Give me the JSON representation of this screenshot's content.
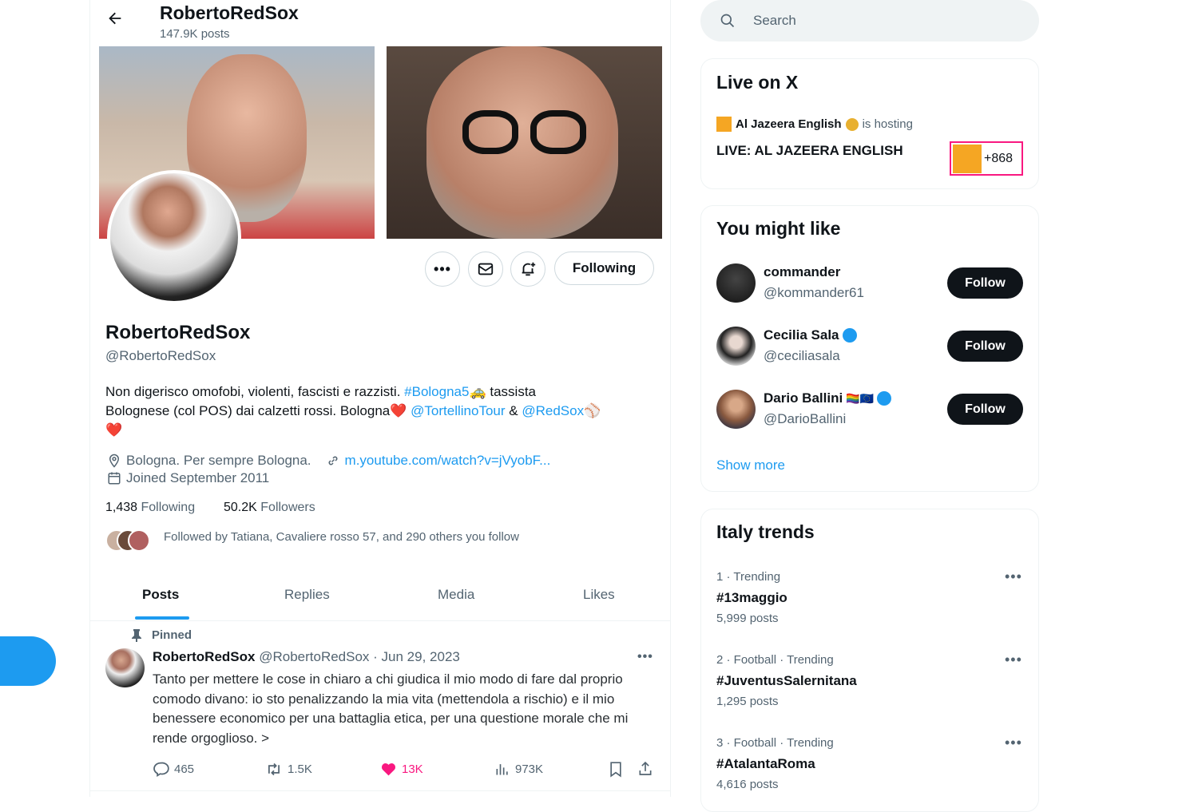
{
  "header": {
    "title": "RobertoRedSox",
    "post_count": "147.9K posts"
  },
  "profile": {
    "name": "RobertoRedSox",
    "handle": "@RobertoRedSox",
    "bio": {
      "line1_text": "Non digerisco omofobi, violenti, fascisti e razzisti. ",
      "hashtag": "#Bologna5",
      "emoji_taxi": "🚕",
      "line1_rest": " tassista",
      "line2_text": "Bolognese (col POS) dai calzetti rossi. Bologna",
      "emoji_heart": "❤️",
      "mention1": "@TortellinoTour",
      "amp": " & ",
      "mention2": "@RedSox",
      "emoji_ball": "⚾"
    },
    "location": "Bologna. Per sempre Bologna.",
    "website": "m.youtube.com/watch?v=jVyobF...",
    "joined": "Joined September 2011",
    "following_count": "1,438",
    "following_label": "Following",
    "followers_count": "50.2K",
    "followers_label": "Followers",
    "followed_by": "Followed by Tatiana, Cavaliere rosso 57, and 290 others you follow",
    "following_button": "Following"
  },
  "tabs": [
    "Posts",
    "Replies",
    "Media",
    "Likes"
  ],
  "active_tab": "Posts",
  "pinned_post": {
    "pinned_label": "Pinned",
    "author": "RobertoRedSox",
    "handle": "@RobertoRedSox",
    "date": "· Jun 29, 2023",
    "text": "Tanto per mettere le cose in chiaro a chi giudica il mio modo di fare dal proprio comodo divano: io sto penalizzando la mia vita (mettendola a rischio) e il mio benessere economico per una battaglia etica, per una questione morale che mi rende orgoglioso. >",
    "replies": "465",
    "reposts": "1.5K",
    "likes": "13K",
    "views": "973K"
  },
  "search": {
    "placeholder": "Search"
  },
  "live": {
    "title": "Live on X",
    "host": "Al Jazeera English",
    "hosting": "is hosting",
    "stream_title": "LIVE: AL JAZEERA ENGLISH",
    "listeners": "+868"
  },
  "suggestions": {
    "title": "You might like",
    "follow_label": "Follow",
    "show_more": "Show more",
    "items": [
      {
        "name": "commander",
        "handle": "@kommander61",
        "verified": false
      },
      {
        "name": "Cecilia Sala",
        "handle": "@ceciliasala",
        "verified": true
      },
      {
        "name": "Dario Ballini",
        "handle": "@DarioBallini",
        "verified": true,
        "flags": "🏳️‍🌈🇪🇺"
      }
    ]
  },
  "trends": {
    "title": "Italy trends",
    "items": [
      {
        "meta": "1 · Trending",
        "name": "#13maggio",
        "posts": "5,999 posts"
      },
      {
        "meta": "2 · Football · Trending",
        "name": "#JuventusSalernitana",
        "posts": "1,295 posts"
      },
      {
        "meta": "3 · Football · Trending",
        "name": "#AtalantaRoma",
        "posts": "4,616 posts"
      }
    ]
  },
  "colors": {
    "accent": "#1d9bf0",
    "like": "#f91880",
    "live_highlight": "#f91880",
    "aljazeera": "#f5a623"
  }
}
